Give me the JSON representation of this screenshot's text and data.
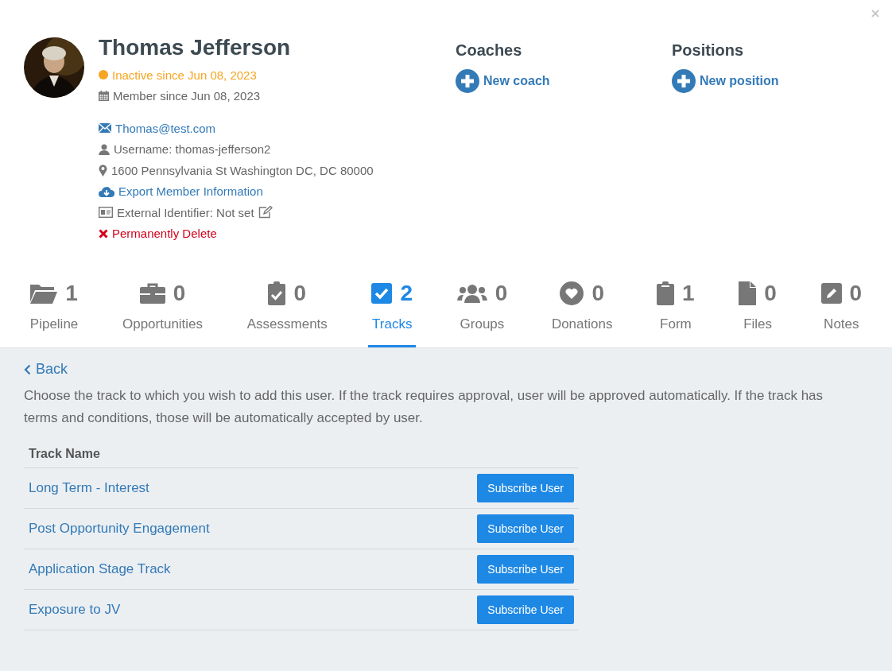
{
  "profile": {
    "name": "Thomas Jefferson",
    "status": {
      "text": "Inactive since Jun 08, 2023",
      "color": "#f5a623"
    },
    "member_since": "Member since Jun 08, 2023",
    "details": [
      {
        "kind": "email",
        "text": "Thomas@test.com"
      },
      {
        "kind": "user",
        "text": "Username: thomas-jefferson2"
      },
      {
        "kind": "location",
        "text": "1600 Pennsylvania St Washington DC, DC 80000"
      },
      {
        "kind": "export",
        "text": "Export Member Information"
      },
      {
        "kind": "identifier",
        "text": "External Identifier: Not set"
      },
      {
        "kind": "delete",
        "text": "Permanently Delete"
      }
    ]
  },
  "coaches": {
    "title": "Coaches",
    "action": "New coach"
  },
  "positions": {
    "title": "Positions",
    "action": "New position"
  },
  "tabs": [
    {
      "label": "Pipeline",
      "count": "1",
      "selected": false
    },
    {
      "label": "Opportunities",
      "count": "0",
      "selected": false
    },
    {
      "label": "Assessments",
      "count": "0",
      "selected": false
    },
    {
      "label": "Tracks",
      "count": "2",
      "selected": true
    },
    {
      "label": "Groups",
      "count": "0",
      "selected": false
    },
    {
      "label": "Donations",
      "count": "0",
      "selected": false
    },
    {
      "label": "Form",
      "count": "1",
      "selected": false
    },
    {
      "label": "Files",
      "count": "0",
      "selected": false
    },
    {
      "label": "Notes",
      "count": "0",
      "selected": false
    }
  ],
  "back": "Back",
  "instructions": "Choose the track to which you wish to add this user. If the track requires approval, user will be approved automatically. If the track has terms and conditions, those will be automatically accepted by user.",
  "table": {
    "columns": [
      "Track Name"
    ],
    "rows": [
      {
        "name": "Long Term - Interest",
        "action": "Subscribe User"
      },
      {
        "name": "Post Opportunity Engagement",
        "action": "Subscribe User"
      },
      {
        "name": "Application Stage Track",
        "action": "Subscribe User"
      },
      {
        "name": "Exposure to JV",
        "action": "Subscribe User"
      }
    ]
  }
}
